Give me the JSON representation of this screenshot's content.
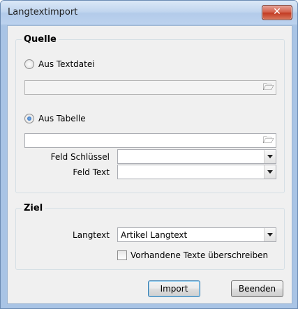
{
  "window": {
    "title": "Langtextimport",
    "close_label": "✕"
  },
  "quelle": {
    "legend": "Quelle",
    "option_textdatei": "Aus Textdatei",
    "option_tabelle": "Aus Tabelle",
    "textdatei_path": "",
    "tabelle_path": "",
    "feld_schluessel_label": "Feld Schlüssel",
    "feld_schluessel_value": "",
    "feld_text_label": "Feld Text",
    "feld_text_value": "",
    "selected_option": "Aus Tabelle"
  },
  "ziel": {
    "legend": "Ziel",
    "langtext_label": "Langtext",
    "langtext_value": "Artikel Langtext",
    "overwrite_label": "Vorhandene Texte überschreiben",
    "overwrite_checked": false
  },
  "buttons": {
    "import": "Import",
    "beenden": "Beenden"
  },
  "icons": {
    "browse": "folder-open-icon",
    "dropdown": "chevron-down-icon",
    "close": "close-icon"
  }
}
